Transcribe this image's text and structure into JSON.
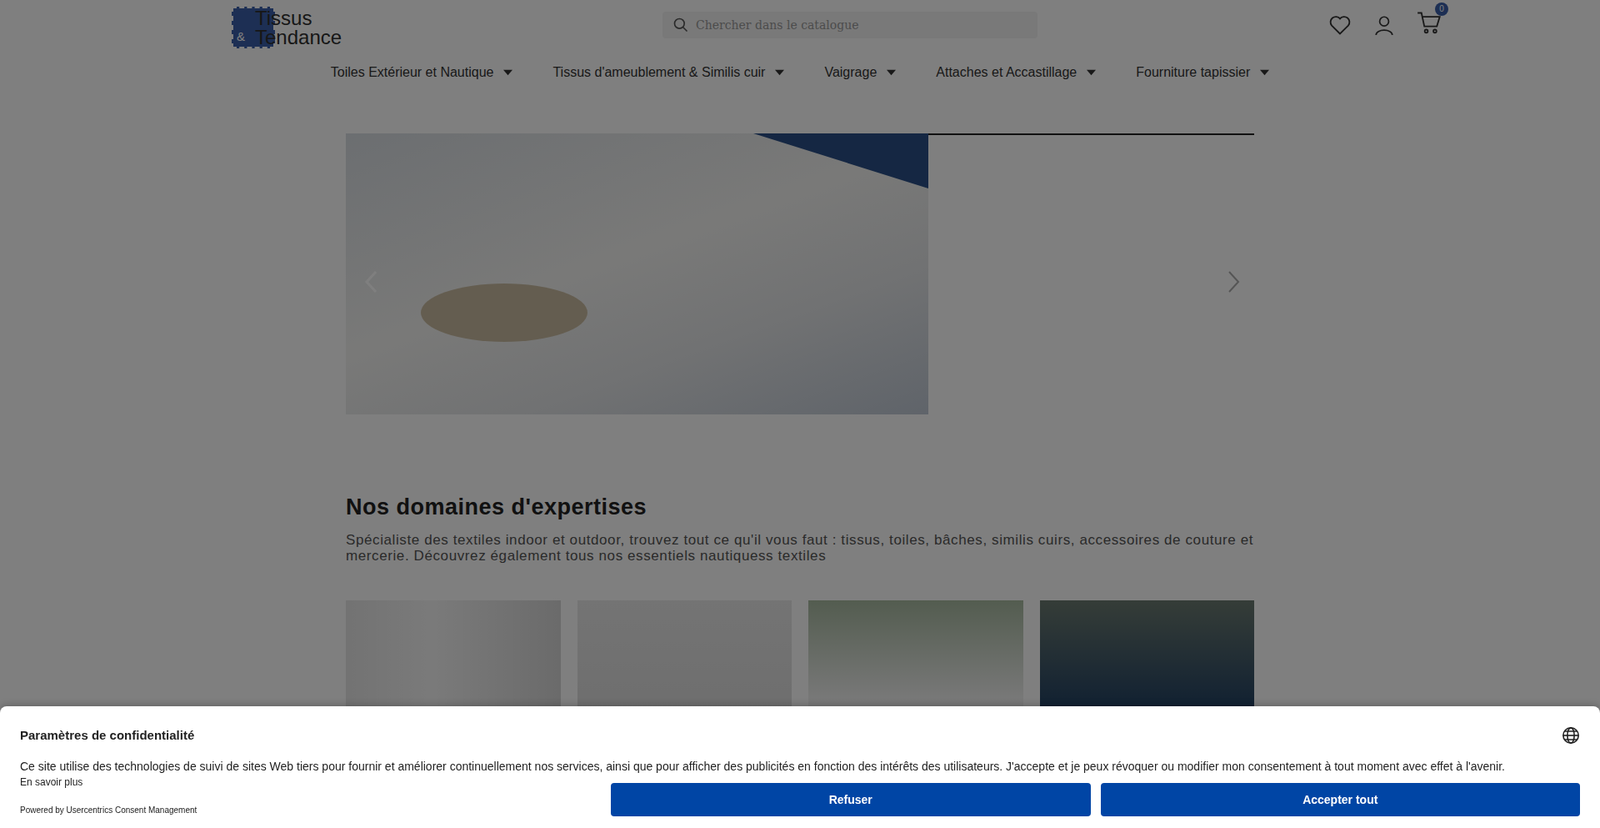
{
  "header": {
    "logo": {
      "mark": "&",
      "line1": "Tissus",
      "line2": "Tendance"
    },
    "search": {
      "placeholder": "Chercher dans le catalogue"
    },
    "cart_count": "0"
  },
  "nav": [
    {
      "label": "Toiles Extérieur et Nautique"
    },
    {
      "label": "Tissus d'ameublement & Similis cuir"
    },
    {
      "label": "Vaigrage"
    },
    {
      "label": "Attaches et Accastillage"
    },
    {
      "label": "Fourniture tapissier"
    }
  ],
  "expertise": {
    "title": "Nos domaines d'expertises",
    "text": "Spécialiste des textiles indoor et outdoor, trouvez tout ce qu'il vous faut : tissus, toiles, bâches, similis cuirs, accessoires de couture et mercerie. Découvrez également tous nos essentiels nautiquess textiles"
  },
  "consent": {
    "title": "Paramètres de confidentialité",
    "text": "Ce site utilise des technologies de suivi de sites Web tiers pour fournir et améliorer continuellement nos services, ainsi que pour afficher des publicités en fonction des intérêts des utilisateurs. J'accepte et je peux révoquer ou modifier mon consentement à tout moment avec effet à l'avenir.",
    "link": "En savoir plus",
    "powered": "Powered by Usercentrics Consent Management",
    "buttons": [
      "Refuser",
      "Accepter tout"
    ]
  }
}
